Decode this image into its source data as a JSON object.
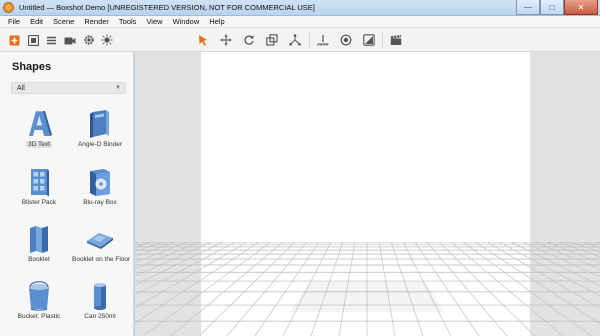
{
  "window": {
    "title": "Untitled — Boxshot Demo [UNREGISTERED VERSION, NOT FOR COMMERCIAL USE]",
    "minimize_glyph": "—",
    "maximize_glyph": "□",
    "close_glyph": "✕"
  },
  "menu": [
    "File",
    "Edit",
    "Scene",
    "Render",
    "Tools",
    "View",
    "Window",
    "Help"
  ],
  "toolbar": {
    "icons": [
      "add-icon",
      "frame-icon",
      "list-icon",
      "camera-icon",
      "gear-icon",
      "light-icon",
      "select-arrow-icon",
      "move-icon",
      "rotate-icon",
      "scale-icon",
      "axis-icon",
      "ground-icon",
      "target-icon",
      "material-icon",
      "render-clapper-icon"
    ],
    "accent_color": "#e86d12"
  },
  "shapes_panel": {
    "title": "Shapes",
    "filter_value": "All",
    "items": [
      {
        "label": "3D Text",
        "icon": "text-3d-icon"
      },
      {
        "label": "Angle-D Binder",
        "icon": "binder-icon"
      },
      {
        "label": "Blister Pack",
        "icon": "blister-pack-icon"
      },
      {
        "label": "Blu-ray Box",
        "icon": "bluray-box-icon"
      },
      {
        "label": "Booklet",
        "icon": "booklet-icon"
      },
      {
        "label": "Booklet on the Floor",
        "icon": "booklet-floor-icon"
      },
      {
        "label": "Bucket: Plastic",
        "icon": "bucket-icon"
      },
      {
        "label": "Can 250ml",
        "icon": "can-icon"
      }
    ]
  }
}
